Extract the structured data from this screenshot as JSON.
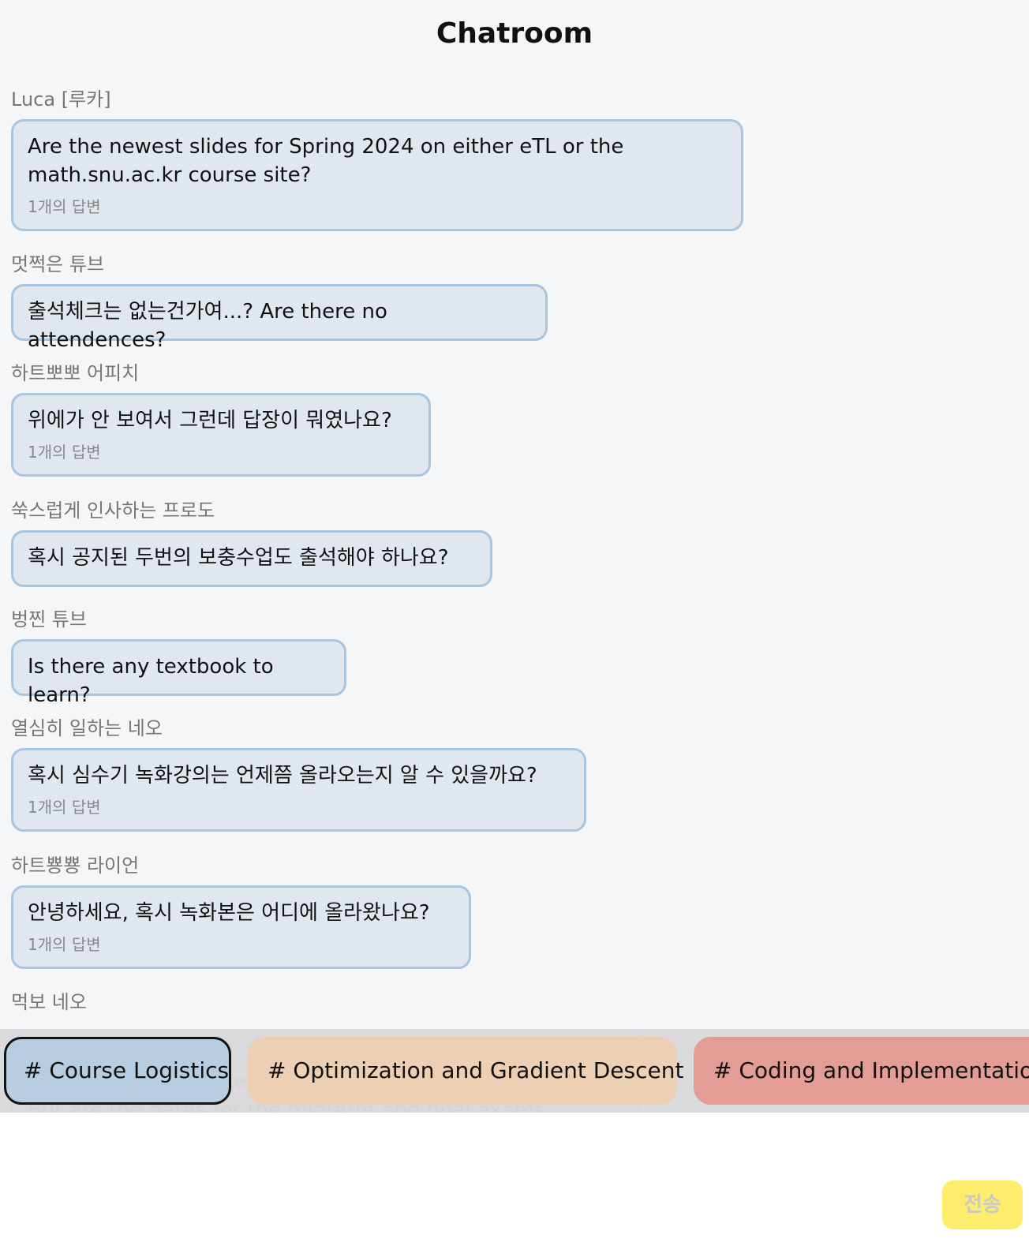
{
  "header": {
    "title": "Chatroom"
  },
  "messages": [
    {
      "sender": "Luca [루카]",
      "text": "Are the newest slides for Spring 2024 on either eTL or the\nmath.snu.ac.kr course site?",
      "replies": "1개의 답변"
    },
    {
      "sender": "멋쩍은 튜브",
      "text": "출석체크는 없는건가여...? Are there no attendences?",
      "replies": ""
    },
    {
      "sender": "하트뽀뽀 어피치",
      "text": "위에가 안 보여서 그런데 답장이 뭐였나요?",
      "replies": "1개의 답변"
    },
    {
      "sender": "쑥스럽게 인사하는 프로도",
      "text": "혹시 공지된 두번의 보충수업도 출석해야 하나요?",
      "replies": ""
    },
    {
      "sender": "벙찐 튜브",
      "text": "Is there any textbook to learn?",
      "replies": ""
    },
    {
      "sender": "열심히 일하는 네오",
      "text": "혹시 심수기 녹화강의는 언제쯤 올라오는지 알 수 있을까요?",
      "replies": "1개의 답변"
    },
    {
      "sender": "하트뿅뿅 라이언",
      "text": "안녕하세요, 혹시 녹화본은 어디에 올라왔나요?",
      "replies": "1개의 답변"
    },
    {
      "sender": "먹보 네오",
      "text": "Hello,\nApologies in advance if I have missed it in class\nBut are the dates for the midterm and final exams available?",
      "replies": ""
    }
  ],
  "channels": [
    {
      "label": "# Course Logistics",
      "color": "#b7cde2",
      "selected": true
    },
    {
      "label": "# Optimization and Gradient Descent",
      "color": "#edd0b3",
      "selected": false
    },
    {
      "label": "# Coding and Implementation",
      "color": "#e39d94",
      "selected": false
    }
  ],
  "composer": {
    "placeholder": "",
    "send_label": "전송"
  }
}
